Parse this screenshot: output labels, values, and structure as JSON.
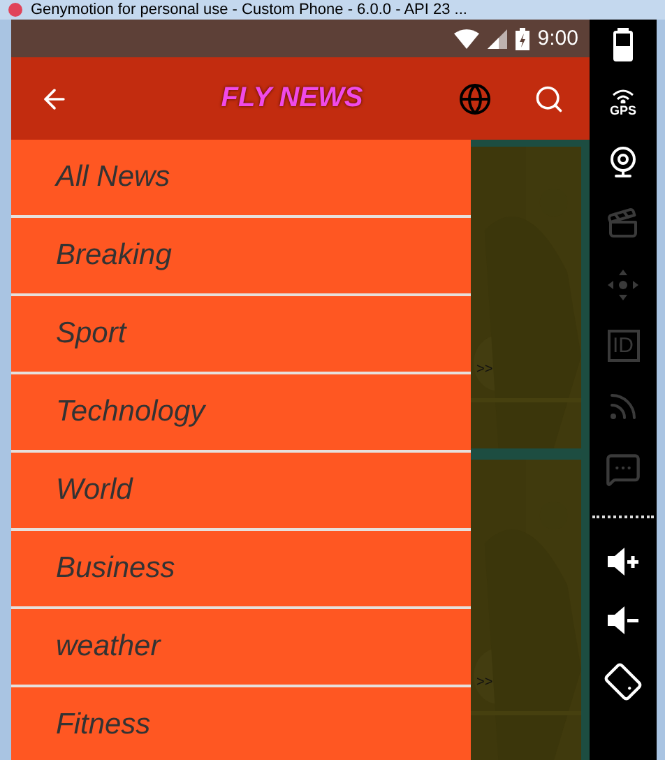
{
  "window": {
    "title": "Genymotion for personal use - Custom Phone - 6.0.0 - API 23 ..."
  },
  "status_bar": {
    "time": "9:00"
  },
  "toolbar": {
    "title": "FLY NEWS"
  },
  "drawer": {
    "items": [
      {
        "label": "All News"
      },
      {
        "label": "Breaking"
      },
      {
        "label": "Sport"
      },
      {
        "label": "Technology"
      },
      {
        "label": "World"
      },
      {
        "label": "Business"
      },
      {
        "label": "weather"
      },
      {
        "label": "Fitness"
      }
    ]
  },
  "content": {
    "cards": [
      {
        "kind": "picture",
        "more": ">>"
      },
      {
        "kind": "picture",
        "more": ">>"
      }
    ]
  },
  "tools": [
    {
      "kind": "battery",
      "disabled": false
    },
    {
      "kind": "gps",
      "label": "GPS",
      "disabled": false
    },
    {
      "kind": "webcam",
      "disabled": false
    },
    {
      "kind": "clapper",
      "disabled": true
    },
    {
      "kind": "dpad",
      "disabled": true
    },
    {
      "kind": "id",
      "label": "ID",
      "disabled": true
    },
    {
      "kind": "rss",
      "disabled": true
    },
    {
      "kind": "chat",
      "disabled": true
    },
    {
      "kind": "divider"
    },
    {
      "kind": "volume-up",
      "disabled": false
    },
    {
      "kind": "volume-down",
      "disabled": false
    },
    {
      "kind": "rotate",
      "disabled": false
    }
  ]
}
